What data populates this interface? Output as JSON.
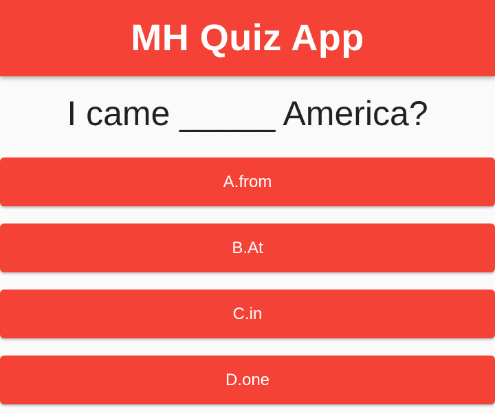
{
  "app_bar": {
    "title": "MH Quiz App",
    "color": "#f44336"
  },
  "question": {
    "text": "I came _____ America?"
  },
  "answers": [
    {
      "label": "A.from"
    },
    {
      "label": "B.At"
    },
    {
      "label": "C.in"
    },
    {
      "label": "D.one"
    }
  ],
  "colors": {
    "accent": "#f44336",
    "background": "#fafafa",
    "question_text": "#212121",
    "button_text": "#ffffff"
  }
}
